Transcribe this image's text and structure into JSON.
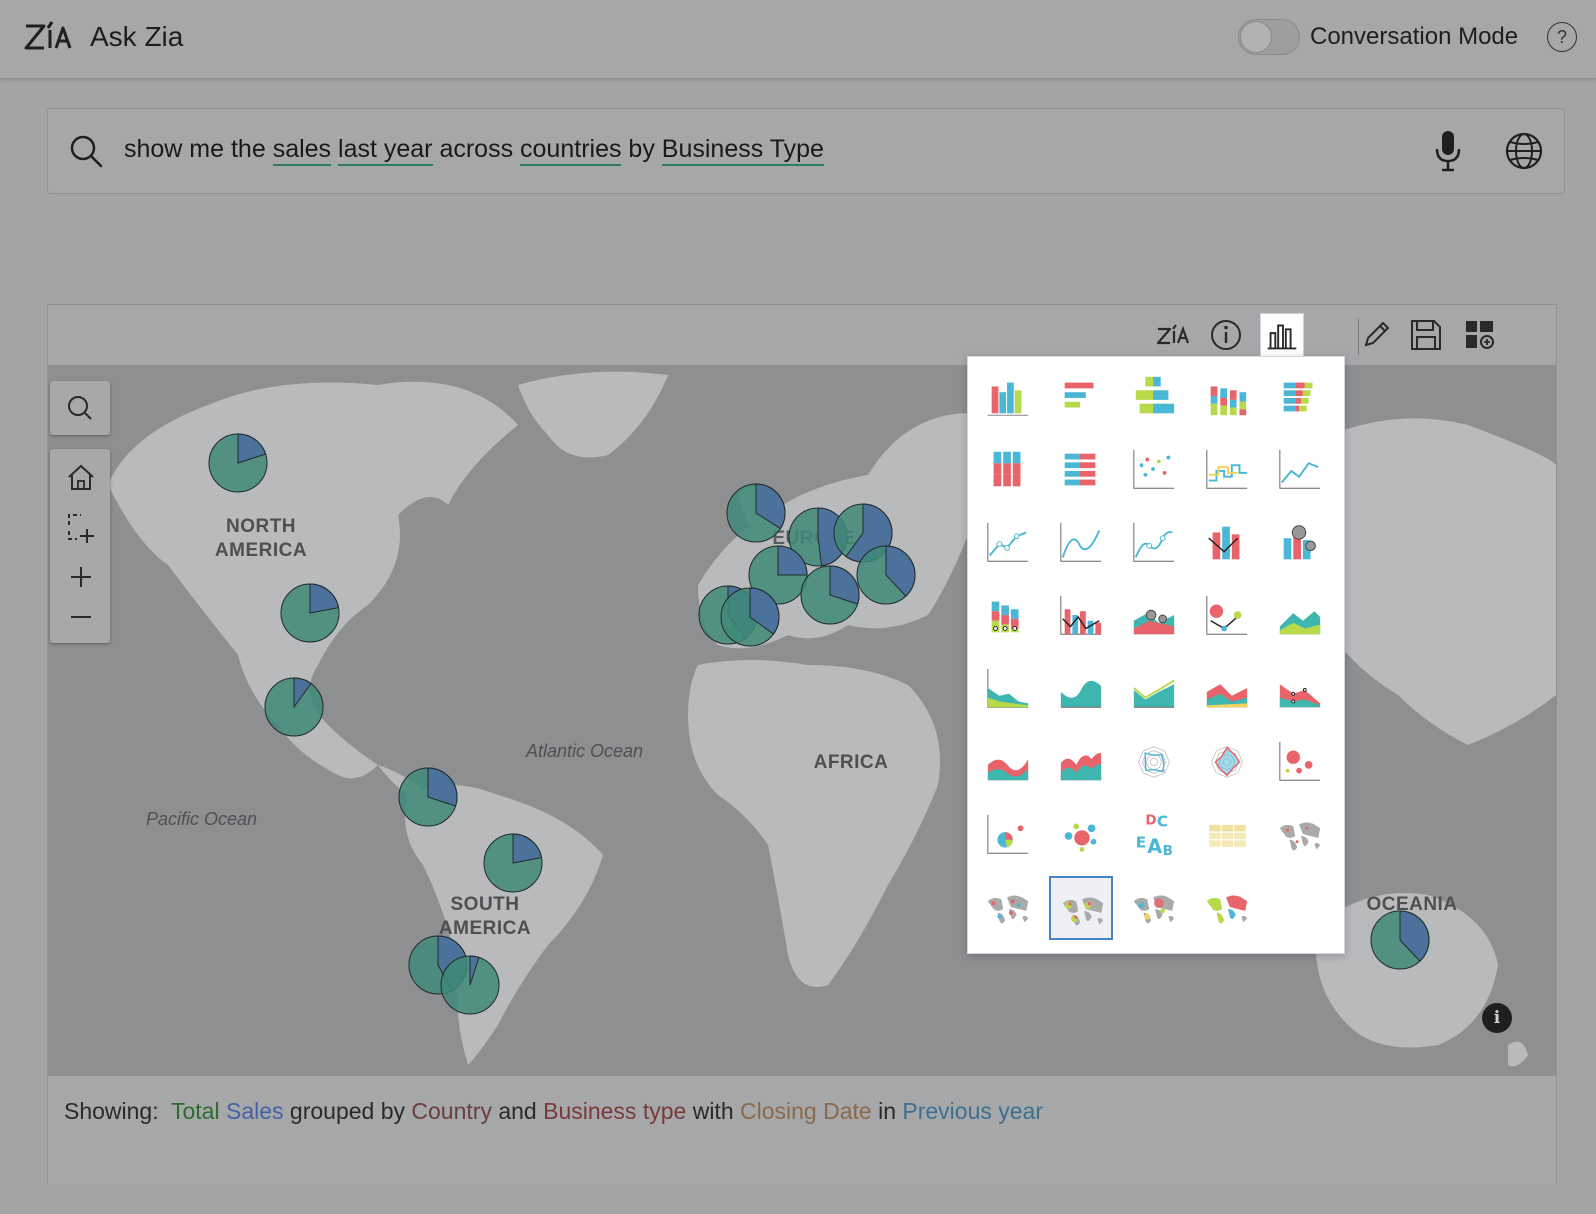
{
  "header": {
    "app_title": "Ask Zia",
    "conversation_mode_label": "Conversation Mode",
    "conversation_mode_on": false,
    "help_label": "?"
  },
  "search": {
    "query_tokens": [
      {
        "text": "show me the ",
        "entity": false
      },
      {
        "text": "sales",
        "entity": true
      },
      {
        "text": " ",
        "entity": false
      },
      {
        "text": "last year",
        "entity": true
      },
      {
        "text": " across ",
        "entity": false
      },
      {
        "text": "countries",
        "entity": true
      },
      {
        "text": " by ",
        "entity": false
      },
      {
        "text": "Business Type",
        "entity": true
      }
    ]
  },
  "toolbar": {
    "buttons": [
      {
        "name": "zia-insights-icon"
      },
      {
        "name": "info-icon"
      },
      {
        "name": "chart-type-icon",
        "active": true
      },
      {
        "name": "edit-icon"
      },
      {
        "name": "save-icon"
      },
      {
        "name": "add-to-dashboard-icon"
      }
    ]
  },
  "map": {
    "regions": {
      "north_america": "NORTH\nAMERICA",
      "south_america": "SOUTH\nAMERICA",
      "europe": "EUROPE",
      "africa": "AFRICA",
      "oceania": "OCEANIA"
    },
    "oceans": {
      "atlantic": "Atlantic Ocean",
      "pacific": "Pacific Ocean"
    },
    "pie_colors": {
      "primary": "#3f8a78",
      "secondary": "#4b6f9e"
    },
    "pies": [
      {
        "share": 0.2
      },
      {
        "share": 0.22
      },
      {
        "share": 0.1
      },
      {
        "share": 0.3
      },
      {
        "share": 0.22
      },
      {
        "share": 0.34
      },
      {
        "share": 0.48
      },
      {
        "share": 0.6
      },
      {
        "share": 0.25
      },
      {
        "share": 0.3
      },
      {
        "share": 0.38
      },
      {
        "share": 0.4
      },
      {
        "share": 0.35
      },
      {
        "share": 0.42
      },
      {
        "share": 0.05
      },
      {
        "share": 0.38
      }
    ]
  },
  "footer": {
    "showing_label": "Showing:",
    "parts": [
      {
        "text": "Total",
        "color": "#2f6b2f"
      },
      {
        "text": " ",
        "color": "#2a2a2a"
      },
      {
        "text": "Sales",
        "color": "#4661a6"
      },
      {
        "text": " grouped by ",
        "color": "#2a2a2a"
      },
      {
        "text": "Country",
        "color": "#6a3f3b"
      },
      {
        "text": " and ",
        "color": "#2a2a2a"
      },
      {
        "text": "Business type",
        "color": "#7a3a3a"
      },
      {
        "text": " with ",
        "color": "#2a2a2a"
      },
      {
        "text": "Closing Date",
        "color": "#8a6a4a"
      },
      {
        "text": " in ",
        "color": "#2a2a2a"
      },
      {
        "text": "Previous year",
        "color": "#3f6f8e"
      }
    ]
  },
  "chart_picker": {
    "selected_index": 36,
    "items": [
      "bar-chart-icon",
      "horizontal-bar-chart-icon",
      "tornado-chart-icon",
      "stacked-bar-chart-icon",
      "stacked-horizontal-bar-icon",
      "percent-stacked-bar-icon",
      "percent-stacked-horizontal-bar-icon",
      "scatter-chart-icon",
      "step-line-chart-icon",
      "line-chart-icon",
      "line-with-markers-icon",
      "smooth-line-chart-icon",
      "smooth-line-markers-icon",
      "bar-line-combo-icon",
      "bar-bubble-combo-icon",
      "stacked-bar-markers-icon",
      "bar-line-combo-2-icon",
      "area-bubble-combo-icon",
      "bubble-line-icon",
      "area-chart-icon",
      "area-markers-icon",
      "smooth-area-chart-icon",
      "area-line-icon",
      "stacked-area-icon",
      "stacked-area-markers-icon",
      "smooth-stacked-area-icon",
      "smooth-stacked-area-2-icon",
      "web-chart-icon",
      "filled-web-chart-icon",
      "bubble-chart-icon",
      "bubble-pie-chart-icon",
      "packed-bubble-chart-icon",
      "word-cloud-icon",
      "table-icon",
      "geo-map-icon",
      "geo-map-scatter-icon",
      "geo-map-pie-icon",
      "geo-map-bubble-icon",
      "filled-geo-map-icon"
    ]
  }
}
